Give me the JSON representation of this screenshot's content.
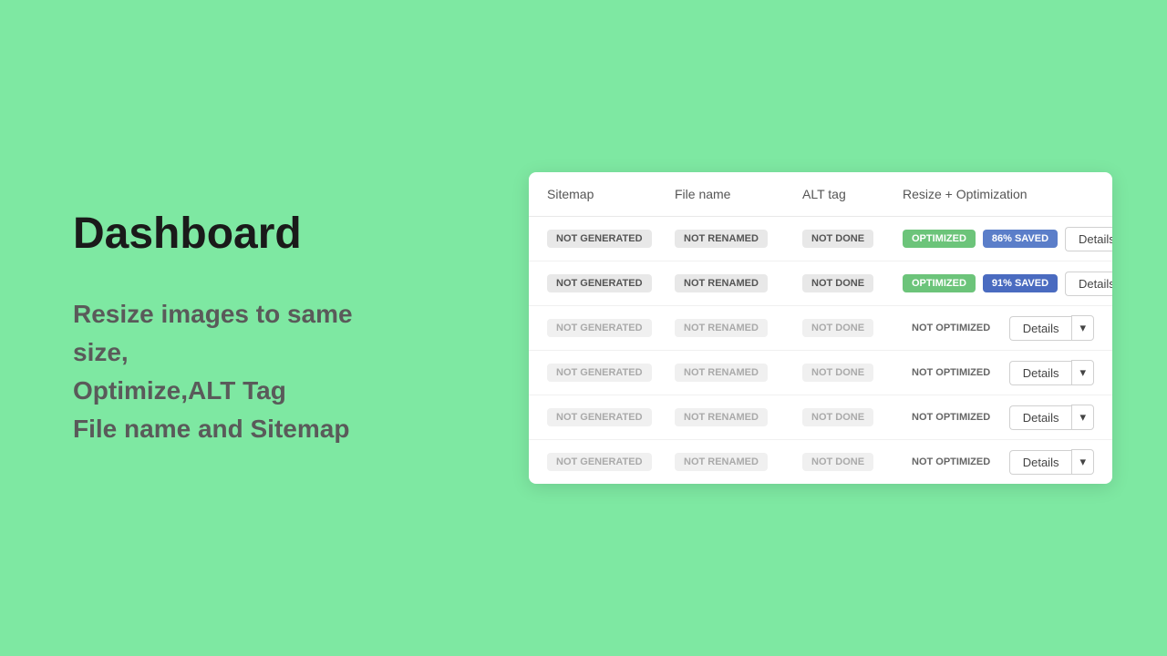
{
  "left": {
    "title": "Dashboard",
    "subtitle_line1": "Resize images to same size,",
    "subtitle_line2": "Optimize,ALT Tag",
    "subtitle_line3": "File name and Sitemap"
  },
  "table": {
    "headers": [
      "Sitemap",
      "File name",
      "ALT tag",
      "Resize + Optimization"
    ],
    "rows": [
      {
        "sitemap": "NOT GENERATED",
        "filename": "NOT RENAMED",
        "alttag": "NOT DONE",
        "optimization_type": "active",
        "optimized_label": "OPTIMIZED",
        "saved_label": "86% SAVED",
        "saved_class": "saved-86",
        "not_optimized": false
      },
      {
        "sitemap": "NOT GENERATED",
        "filename": "NOT RENAMED",
        "alttag": "NOT DONE",
        "optimization_type": "active",
        "optimized_label": "OPTIMIZED",
        "saved_label": "91% SAVED",
        "saved_class": "saved-91",
        "not_optimized": false
      },
      {
        "sitemap": "NOT GENERATED",
        "filename": "NOT RENAMED",
        "alttag": "NOT DONE",
        "optimization_type": "not_optimized",
        "not_optimized_label": "NOT OPTIMIZED",
        "not_optimized": true
      },
      {
        "sitemap": "NOT GENERATED",
        "filename": "NOT RENAMED",
        "alttag": "NOT DONE",
        "optimization_type": "not_optimized",
        "not_optimized_label": "NOT OPTIMIZED",
        "not_optimized": true
      },
      {
        "sitemap": "NOT GENERATED",
        "filename": "NOT RENAMED",
        "alttag": "NOT DONE",
        "optimization_type": "not_optimized",
        "not_optimized_label": "NOT OPTIMIZED",
        "not_optimized": true
      },
      {
        "sitemap": "NOT GENERATED",
        "filename": "NOT RENAMED",
        "alttag": "NOT DONE",
        "optimization_type": "not_optimized",
        "not_optimized_label": "NOT OPTIMIZED",
        "not_optimized": true
      }
    ],
    "details_label": "Details",
    "arrow_label": "▾"
  }
}
